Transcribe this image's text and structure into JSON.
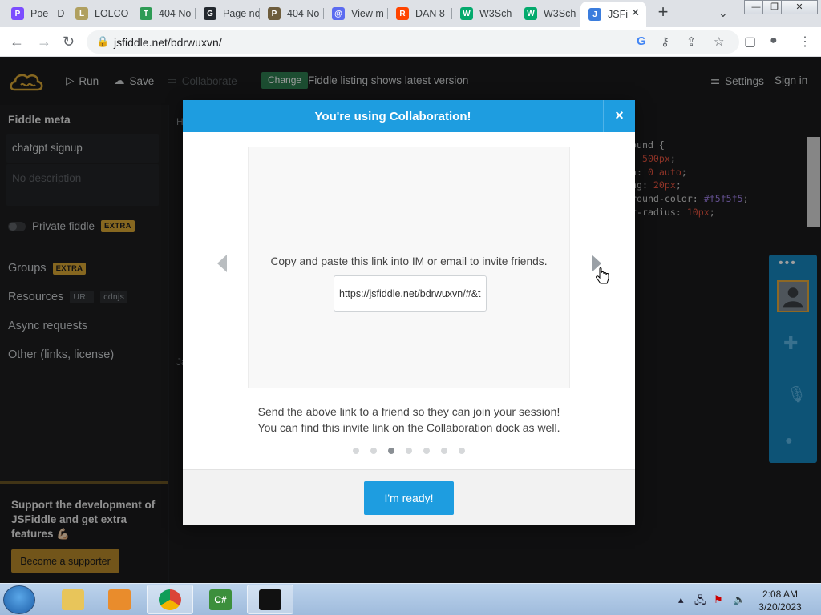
{
  "browser": {
    "tabs": [
      {
        "title": "Poe - D",
        "color": "#7c4dff",
        "glyph": "P"
      },
      {
        "title": "LOLCO",
        "color": "#b0a060",
        "glyph": "L"
      },
      {
        "title": "404 No",
        "color": "#2e9b55",
        "glyph": "T"
      },
      {
        "title": "Page no",
        "color": "#24292f",
        "glyph": "G"
      },
      {
        "title": "404 No",
        "color": "#6d5c3c",
        "glyph": "P"
      },
      {
        "title": "View m",
        "color": "#5b6bf0",
        "glyph": "@"
      },
      {
        "title": "DAN 8",
        "color": "#ff4500",
        "glyph": "R"
      },
      {
        "title": "W3Sch",
        "color": "#04aa6d",
        "glyph": "W"
      },
      {
        "title": "W3Sch",
        "color": "#04aa6d",
        "glyph": "W"
      },
      {
        "title": "JSFi",
        "color": "#3b7ddd",
        "glyph": "J"
      }
    ],
    "new_tab": "+",
    "url": "jsfiddle.net/bdrwuxvn/"
  },
  "header": {
    "run": "Run",
    "save": "Save",
    "collaborate": "Collaborate",
    "change_badge": "Change",
    "listing": "Fiddle listing shows latest version",
    "settings": "Settings",
    "signin": "Sign in"
  },
  "sidebar": {
    "title": "Fiddle meta",
    "fiddle_name": "chatgpt signup",
    "description_placeholder": "No description",
    "private_label": "Private fiddle",
    "extra_tag": "EXTRA",
    "groups": "Groups",
    "resources": "Resources",
    "url_tag": "URL",
    "cdnjs_tag": "cdnjs",
    "async": "Async requests",
    "other": "Other (links, license)",
    "support_text": "Support the development of JSFiddle and get extra features 💪🏻",
    "supporter_button": "Become a supporter"
  },
  "editor": {
    "panel_letter_html": "H",
    "panel_letter_js": "Ja",
    "code_lines": [
      {
        "text": "ound {",
        "parts": []
      },
      {
        "text": ": ",
        "value": "500px",
        "suffix": ";"
      },
      {
        "text": "n: ",
        "value": "0 auto",
        "suffix": ";"
      },
      {
        "text": "ng: ",
        "value": "20px",
        "suffix": ";"
      },
      {
        "text": "round-color: ",
        "value": "#f5f5f5",
        "suffix": ";"
      },
      {
        "text": "r-radius: ",
        "value": "10px",
        "suffix": ";"
      }
    ]
  },
  "modal": {
    "title": "You're using Collaboration!",
    "close": "×",
    "copy_text": "Copy and paste this link into IM or email to invite friends.",
    "invite_link": "https://jsfiddle.net/bdrwuxvn/#&togetherjs=",
    "desc_line1": "Send the above link to a friend so they can join your session!",
    "desc_line2": "You can find this invite link on the Collaboration dock as well.",
    "slide_count": 7,
    "current_slide": 3,
    "ready_button": "I'm ready!"
  },
  "taskbar": {
    "time": "2:08 AM",
    "date": "3/20/2023"
  },
  "colors": {
    "accent": "#1e9de0",
    "extra_tag": "#d8a634",
    "supporter": "#b8892a"
  }
}
